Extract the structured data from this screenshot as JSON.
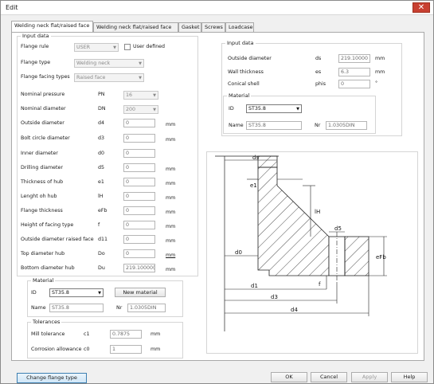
{
  "window": {
    "title": "Edit",
    "close_glyph": "✕"
  },
  "tabs": [
    "Welding neck flat/raised face",
    "Welding neck flat/raised face",
    "Gasket",
    "Screws",
    "Loadcase"
  ],
  "left_input": {
    "title": "Input data",
    "flange_rule": {
      "label": "Flange rule",
      "value": "USER",
      "user_defined_label": "User defined"
    },
    "flange_type": {
      "label": "Flange type",
      "value": "Welding neck"
    },
    "flange_facing": {
      "label": "Flange facing types",
      "value": "Raised face"
    },
    "rows": [
      {
        "label": "Nominal pressure",
        "sym": "PN",
        "value": "16",
        "unit": "",
        "kind": "combo"
      },
      {
        "label": "Nominal diameter",
        "sym": "DN",
        "value": "200",
        "unit": "",
        "kind": "combo"
      },
      {
        "label": "Outside diameter",
        "sym": "d4",
        "value": "0",
        "unit": "mm",
        "kind": "input"
      },
      {
        "label": "Bolt circle diameter",
        "sym": "d3",
        "value": "0",
        "unit": "mm",
        "kind": "input"
      },
      {
        "label": "Inner diameter",
        "sym": "d0",
        "value": "0",
        "unit": "",
        "kind": "input"
      },
      {
        "label": "Drilling diameter",
        "sym": "d5",
        "value": "0",
        "unit": "mm",
        "kind": "input"
      },
      {
        "label": "Thickness of hub",
        "sym": "e1",
        "value": "0",
        "unit": "mm",
        "kind": "input"
      },
      {
        "label": "Lenght oh hub",
        "sym": "lH",
        "value": "0",
        "unit": "mm",
        "kind": "input"
      },
      {
        "label": "Flange thickness",
        "sym": "eFb",
        "value": "0",
        "unit": "mm",
        "kind": "input"
      },
      {
        "label": "Height of facing type",
        "sym": "f",
        "value": "0",
        "unit": "mm",
        "kind": "input"
      },
      {
        "label": "Outside diameter raised face",
        "sym": "d11",
        "value": "0",
        "unit": "mm",
        "kind": "input"
      },
      {
        "label": "Top diameter hub",
        "sym": "Do",
        "value": "0",
        "unit": "mm",
        "kind": "input"
      },
      {
        "label": "Bottom diameter hub",
        "sym": "Du",
        "value": "219.10000(",
        "unit": "mm",
        "kind": "input"
      }
    ]
  },
  "left_material": {
    "title": "Material",
    "id_label": "ID",
    "id_value": "ST35.8",
    "new_material_label": "New material",
    "name_label": "Name",
    "name_value": "ST35.8",
    "nr_label": "Nr",
    "nr_value": "1.0305DIN"
  },
  "tolerances": {
    "title": "Tolerances",
    "mill": {
      "label": "Mill tolerance",
      "sym": "c1",
      "value": "0.7875",
      "unit": "mm"
    },
    "corrosion": {
      "label": "Corrosion allowance",
      "sym": "c0",
      "value": "1",
      "unit": "mm"
    }
  },
  "right_input": {
    "title": "Input data",
    "rows": [
      {
        "label": "Outside diameter",
        "sym": "ds",
        "value": "219.10000",
        "unit": "mm"
      },
      {
        "label": "Wall thickness",
        "sym": "es",
        "value": "6.3",
        "unit": "mm"
      },
      {
        "label": "Conical shell",
        "sym": "phis",
        "value": "0",
        "unit": "°"
      }
    ],
    "material": {
      "title": "Material",
      "id_label": "ID",
      "id_value": "ST35.8",
      "name_label": "Name",
      "name_value": "ST35.8",
      "nr_label": "Nr",
      "nr_value": "1.0305DIN"
    }
  },
  "drawing": {
    "labels": {
      "ds": "ds",
      "e1": "e1",
      "lH": "lH",
      "d5": "d5",
      "d0": "d0",
      "eFb": "eFb",
      "f": "f",
      "d1": "d1",
      "d3": "d3",
      "d4": "d4"
    }
  },
  "footer": {
    "change_flange": "Change flange type",
    "ok": "OK",
    "cancel": "Cancel",
    "apply": "Apply",
    "help": "Help"
  },
  "colors": {
    "close": "#c84031",
    "focus_border": "#3c7fb1"
  }
}
